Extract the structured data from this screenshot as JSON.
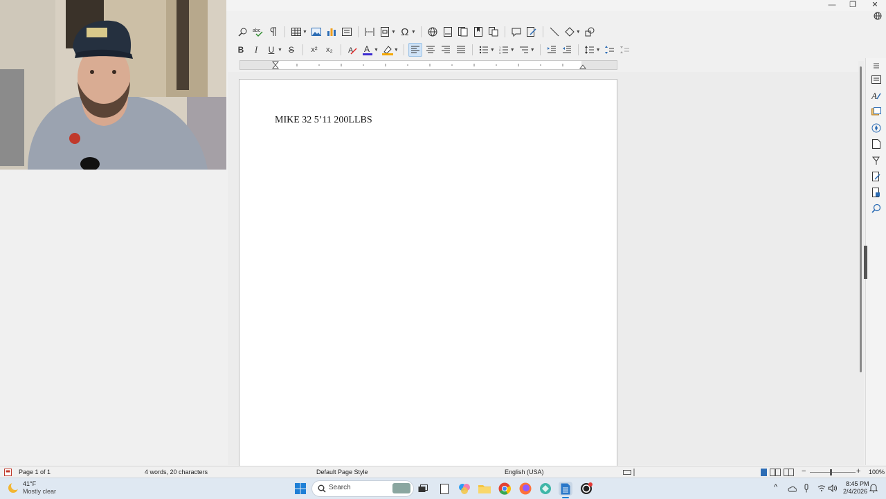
{
  "window": {
    "minimize": "—",
    "maximize": "❐",
    "close": "✕"
  },
  "document": {
    "text": "MIKE 32 5’11 200LLBS"
  },
  "status": {
    "page": "Page 1 of 1",
    "words": "4 words, 20 characters",
    "page_style": "Default Page Style",
    "language": "English (USA)",
    "zoom": "100%"
  },
  "taskbar": {
    "weather_temp": "41°F",
    "weather_desc": "Mostly clear",
    "search_placeholder": "Search",
    "time": "8:45 PM",
    "date": "2/4/2026"
  },
  "colors": {
    "accent": "#cfe3f7",
    "font_color_bar": "#3b2bd0",
    "highlight_bar": "#f5a800"
  }
}
